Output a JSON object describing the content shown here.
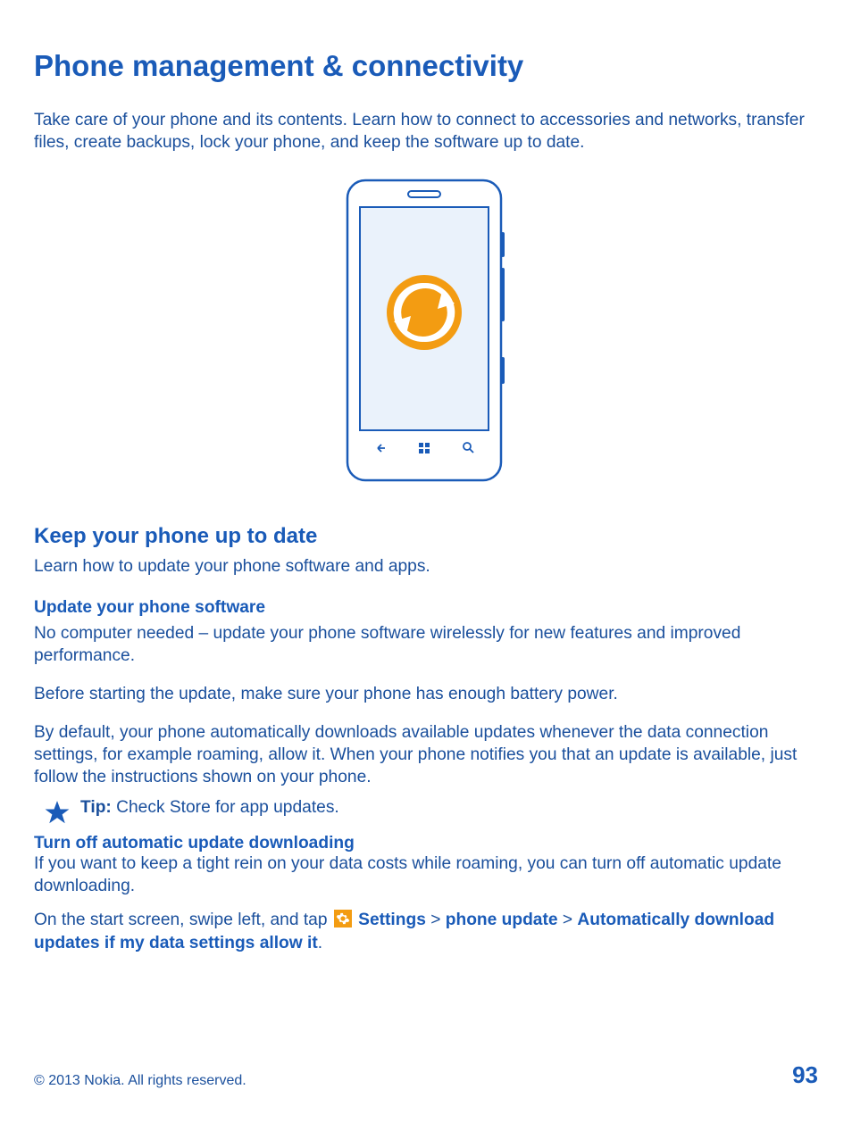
{
  "title": "Phone management & connectivity",
  "intro": "Take care of your phone and its contents. Learn how to connect to accessories and networks, transfer files, create backups, lock your phone, and keep the software up to date.",
  "section1": {
    "heading": "Keep your phone up to date",
    "lead": "Learn how to update your phone software and apps."
  },
  "update_sw": {
    "heading": "Update your phone software",
    "p1": "No computer needed – update your phone software wirelessly for new features and improved performance.",
    "p2": "Before starting the update, make sure your phone has enough battery power.",
    "p3": "By default, your phone automatically downloads available updates whenever the data connection settings, for example roaming, allow it. When your phone notifies you that an update is available, just follow the instructions shown on your phone."
  },
  "tip": {
    "label": "Tip:",
    "text": " Check Store for app updates."
  },
  "turn_off": {
    "heading": "Turn off automatic update downloading",
    "p1": "If you want to keep a tight rein on your data costs while roaming, you can turn off automatic update downloading.",
    "path_intro": "On the start screen, swipe left, and tap ",
    "settings": "Settings",
    "sep": " > ",
    "phone_update": "phone update",
    "auto_dl": "Automatically download updates if my data settings allow it",
    "dot": "."
  },
  "footer": {
    "copyright": "© 2013 Nokia. All rights reserved.",
    "page": "93"
  }
}
